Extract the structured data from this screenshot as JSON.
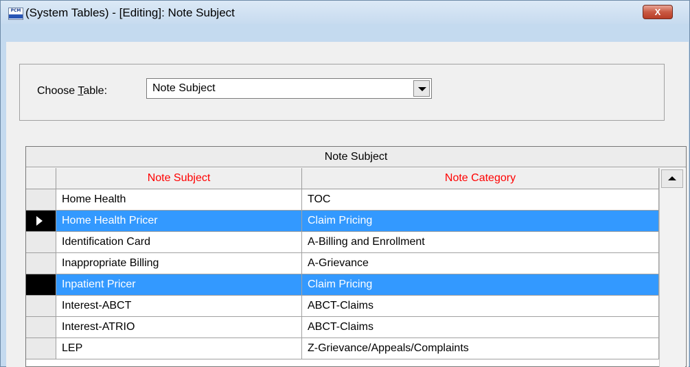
{
  "window": {
    "title": "(System Tables) - [Editing]:  Note Subject",
    "icon_text": "PCM",
    "close_glyph": "X"
  },
  "chooser": {
    "label": "Choose Table:",
    "selected": "Note Subject"
  },
  "grid": {
    "caption": "Note Subject",
    "columns": [
      "Note Subject",
      "Note Category"
    ],
    "rows": [
      {
        "subject": "Home Health",
        "category": "TOC",
        "selected": false,
        "indicator": ""
      },
      {
        "subject": "Home Health Pricer",
        "category": "Claim Pricing",
        "selected": true,
        "indicator": "current"
      },
      {
        "subject": "Identification Card",
        "category": "A-Billing and Enrollment",
        "selected": false,
        "indicator": ""
      },
      {
        "subject": "Inappropriate Billing",
        "category": "A-Grievance",
        "selected": false,
        "indicator": ""
      },
      {
        "subject": "Inpatient Pricer",
        "category": "Claim Pricing",
        "selected": true,
        "indicator": "selected"
      },
      {
        "subject": "Interest-ABCT",
        "category": "ABCT-Claims",
        "selected": false,
        "indicator": ""
      },
      {
        "subject": "Interest-ATRIO",
        "category": "ABCT-Claims",
        "selected": false,
        "indicator": ""
      },
      {
        "subject": "LEP",
        "category": "Z-Grievance/Appeals/Complaints",
        "selected": false,
        "indicator": ""
      }
    ]
  },
  "colors": {
    "header_text": "#ff0000",
    "selection": "#3399ff"
  }
}
